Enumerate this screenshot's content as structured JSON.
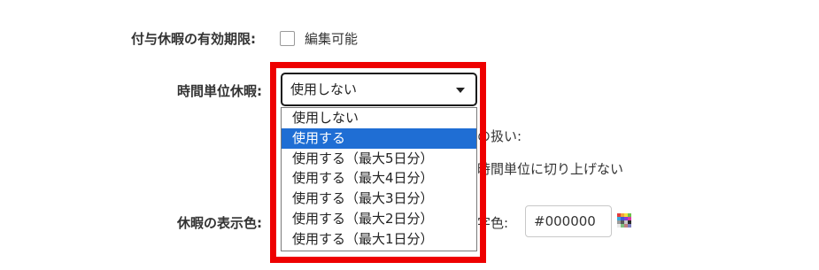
{
  "form": {
    "leave_validity": {
      "label": "付与休暇の有効期限:",
      "checkbox_label": "編集可能"
    },
    "hourly_leave": {
      "label": "時間単位休暇:",
      "selected_value": "使用しない",
      "options": [
        "使用しない",
        "使用する",
        "使用する（最大5日分）",
        "使用する（最大4日分）",
        "使用する（最大3日分）",
        "使用する（最大2日分）",
        "使用する（最大1日分）"
      ],
      "highlighted_option_index": 1
    },
    "partial_behind_1": "の扱い:",
    "partial_behind_2": "時間単位に切り上げない",
    "display_color": {
      "label": "休暇の表示色:",
      "text_color_label_partial": "字色:",
      "text_color_value": "#000000"
    }
  },
  "colors": {
    "highlight_border": "#ee0000",
    "selected_option_bg": "#1f6ed4",
    "text": "#333333"
  },
  "icons": {
    "palette": "color-palette-icon",
    "dropdown_arrow": "triangle-down-icon"
  }
}
